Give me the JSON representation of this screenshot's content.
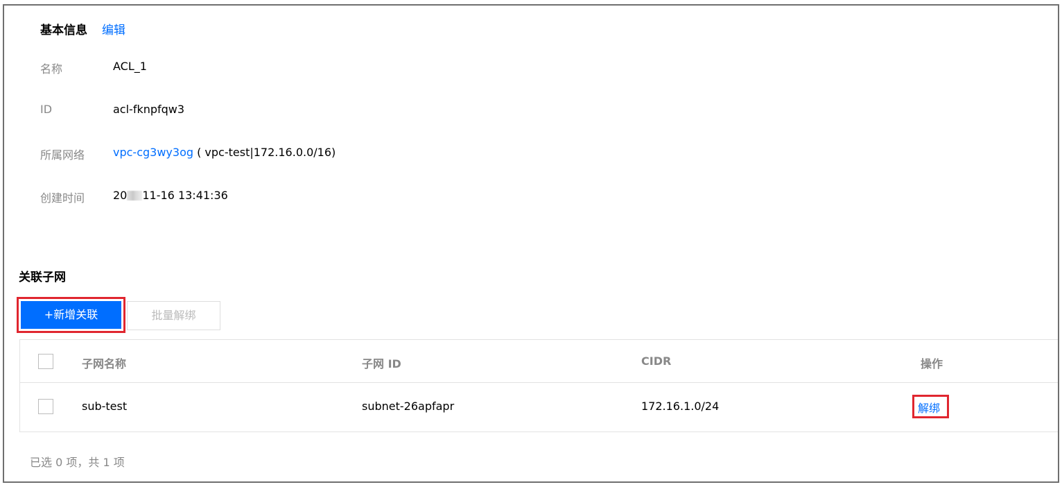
{
  "basic_info": {
    "title": "基本信息",
    "edit_label": "编辑",
    "fields": {
      "name": {
        "label": "名称",
        "value": "ACL_1"
      },
      "id": {
        "label": "ID",
        "value": "acl-fknpfqw3"
      },
      "vpc": {
        "label": "所属网络",
        "link_text": "vpc-cg3wy3og",
        "detail": " ( vpc-test|172.16.0.0/16)"
      },
      "created": {
        "label": "创建时间",
        "value_prefix": "20",
        "value_suffix": "11-16 13:41:36"
      }
    }
  },
  "associated_subnets": {
    "title": "关联子网",
    "add_button_label": "+新增关联",
    "batch_unbind_label": "批量解绑",
    "table": {
      "columns": {
        "name": "子网名称",
        "id": "子网 ID",
        "cidr": "CIDR",
        "action": "操作"
      },
      "rows": [
        {
          "name": "sub-test",
          "id": "subnet-26apfapr",
          "cidr": "172.16.1.0/24",
          "action_label": "解绑"
        }
      ]
    },
    "footer_text": "已选 0 项，共 1 项"
  },
  "colors": {
    "accent": "#006eff",
    "highlight_border": "#e0262f",
    "muted_text": "#888888"
  }
}
